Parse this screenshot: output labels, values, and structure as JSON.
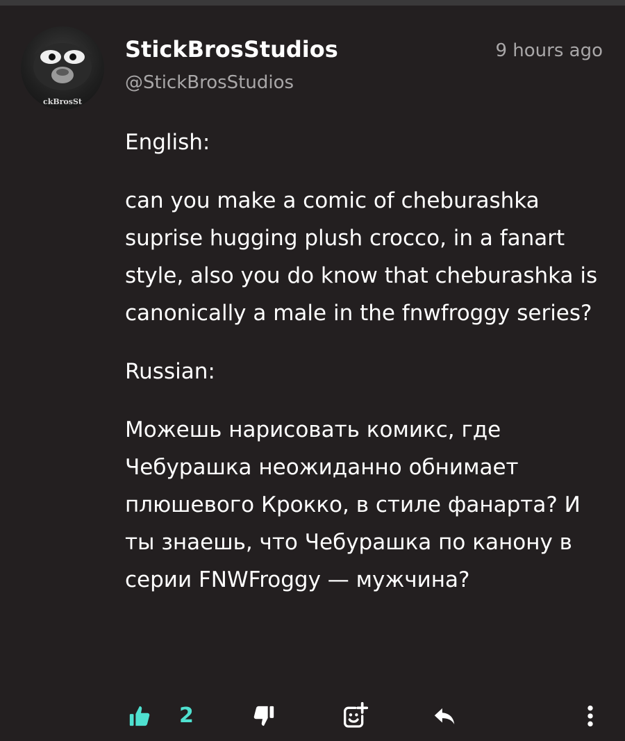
{
  "comment": {
    "author_name": "StickBrosStudios",
    "author_handle": "@StickBrosStudios",
    "timestamp": "9 hours ago",
    "avatar_caption": "ckBrosSt",
    "paragraphs": [
      "English:",
      "can you make a comic of cheburashka suprise hugging plush crocco, in a fanart style, also you do know that cheburashka is canonically a male in the fnwfroggy series?",
      "Russian:",
      "Можешь нарисовать комикс, где Чебурашка неожиданно обнимает плюшевого Крокко, в стиле фанарта? И ты знаешь, что Чебурашка по канону в серии FNWFroggy — мужчина?"
    ],
    "like_count": "2"
  },
  "icons": {
    "like": "thumbs-up-icon",
    "dislike": "thumbs-down-icon",
    "react": "add-reaction-icon",
    "reply": "reply-icon",
    "more": "more-vertical-icon"
  },
  "colors": {
    "background": "#231f20",
    "text": "#ffffff",
    "muted": "#a9a7a8",
    "accent": "#4fe1d0"
  }
}
